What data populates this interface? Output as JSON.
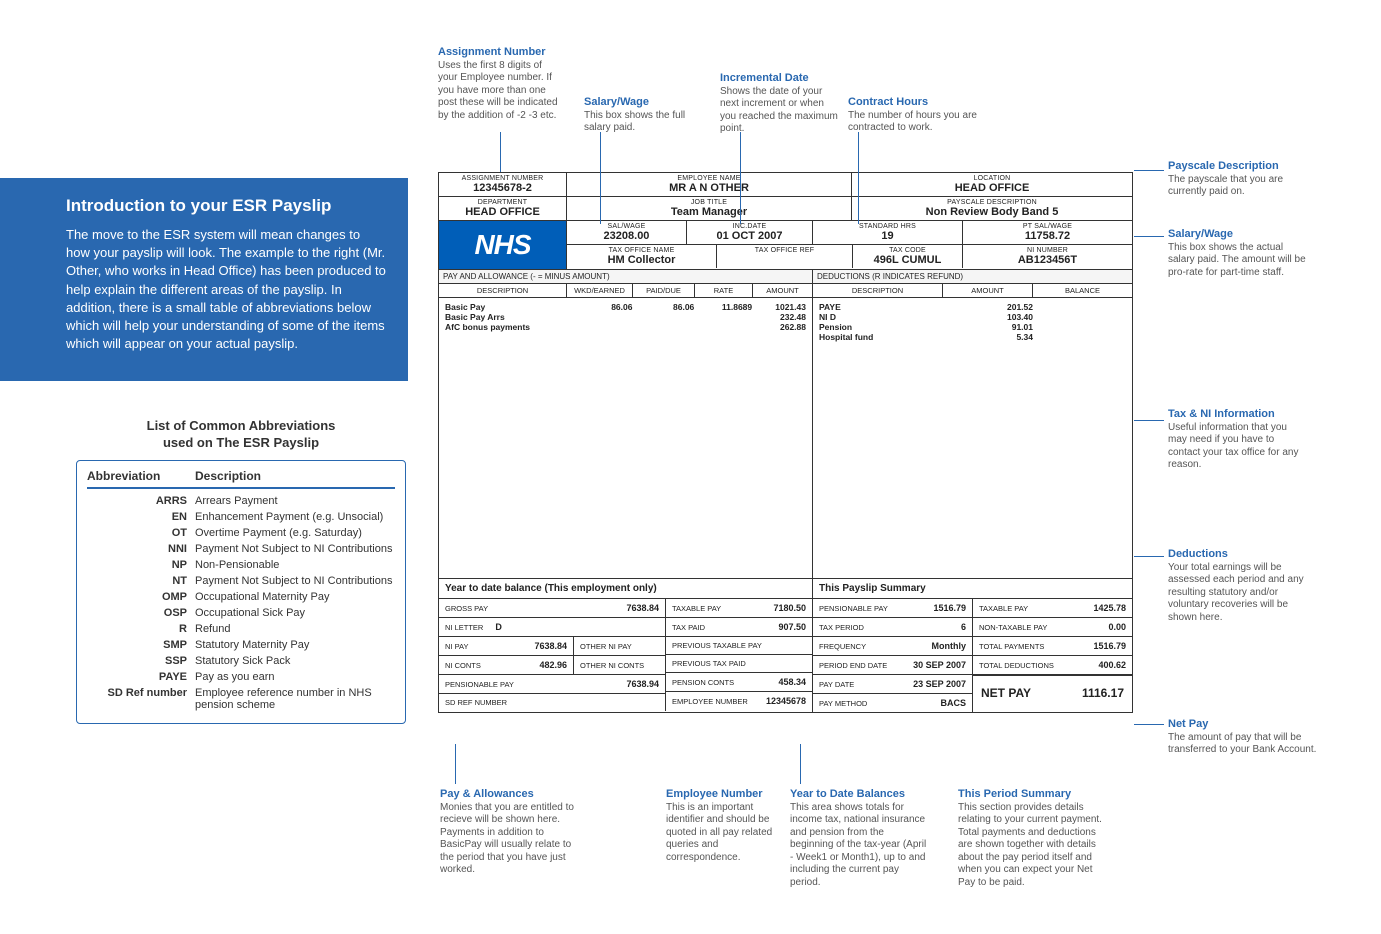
{
  "intro": {
    "title": "Introduction to your ESR Payslip",
    "body": "The move to the ESR system will mean changes to how your payslip will look. The example to the right (Mr. Other, who works in Head Office) has been produced to help explain the different areas of the payslip. In addition, there is a small table of abbreviations below which will help your understanding of some of the items which will appear on your actual payslip."
  },
  "abbrev": {
    "title1": "List of Common Abbreviations",
    "title2": "used on The ESR Payslip",
    "hdr_abbr": "Abbreviation",
    "hdr_desc": "Description",
    "rows": [
      {
        "a": "ARRS",
        "d": "Arrears Payment"
      },
      {
        "a": "EN",
        "d": "Enhancement Payment (e.g. Unsocial)"
      },
      {
        "a": "OT",
        "d": "Overtime Payment (e.g. Saturday)"
      },
      {
        "a": "NNI",
        "d": "Payment Not Subject to NI Contributions"
      },
      {
        "a": "NP",
        "d": "Non-Pensionable"
      },
      {
        "a": "NT",
        "d": "Payment Not Subject to NI Contributions"
      },
      {
        "a": "OMP",
        "d": "Occupational Maternity Pay"
      },
      {
        "a": "OSP",
        "d": "Occupational Sick Pay"
      },
      {
        "a": "R",
        "d": "Refund"
      },
      {
        "a": "SMP",
        "d": "Statutory Maternity Pay"
      },
      {
        "a": "SSP",
        "d": "Statutory Sick Pack"
      },
      {
        "a": "PAYE",
        "d": "Pay as you earn"
      },
      {
        "a": "SD Ref number",
        "d": "Employee reference number in NHS pension scheme"
      }
    ]
  },
  "payslip": {
    "logo": "NHS",
    "assignment_number_lbl": "ASSIGNMENT NUMBER",
    "assignment_number": "12345678-2",
    "employee_name_lbl": "EMPLOYEE NAME",
    "employee_name": "MR A N OTHER",
    "location_lbl": "LOCATION",
    "location": "HEAD OFFICE",
    "department_lbl": "DEPARTMENT",
    "department": "HEAD OFFICE",
    "job_title_lbl": "JOB TITLE",
    "job_title": "Team Manager",
    "payscale_lbl": "PAYSCALE DESCRIPTION",
    "payscale": "Non Review Body Band 5",
    "salwage_lbl": "SAL/WAGE",
    "salwage": "23208.00",
    "incdate_lbl": "INC.DATE",
    "incdate": "01 OCT 2007",
    "stdhrs_lbl": "STANDARD HRS",
    "stdhrs": "19",
    "ptsal_lbl": "PT SAL/WAGE",
    "ptsal": "11758.72",
    "taxoffice_lbl": "TAX OFFICE NAME",
    "taxoffice": "HM Collector",
    "taxref_lbl": "TAX OFFICE REF",
    "taxref": "",
    "taxcode_lbl": "TAX CODE",
    "taxcode": "496L CUMUL",
    "ninum_lbl": "NI NUMBER",
    "ninum": "AB123456T",
    "pay_section_hdr": "PAY AND ALLOWANCE (- = MINUS AMOUNT)",
    "ded_section_hdr": "DEDUCTIONS (R INDICATES REFUND)",
    "pay_cols": {
      "desc": "DESCRIPTION",
      "wkd": "WKD/EARNED",
      "paid": "PAID/DUE",
      "rate": "RATE",
      "amt": "AMOUNT"
    },
    "ded_cols": {
      "desc": "DESCRIPTION",
      "amt": "AMOUNT",
      "bal": "BALANCE"
    },
    "pay_rows": [
      {
        "desc": "Basic Pay",
        "wkd": "86.06",
        "paid": "86.06",
        "rate": "11.8689",
        "amt": "1021.43"
      },
      {
        "desc": "Basic Pay Arrs",
        "wkd": "",
        "paid": "",
        "rate": "",
        "amt": "232.48"
      },
      {
        "desc": "AfC bonus payments",
        "wkd": "",
        "paid": "",
        "rate": "",
        "amt": "262.88"
      }
    ],
    "ded_rows": [
      {
        "desc": "PAYE",
        "amt": "201.52",
        "bal": ""
      },
      {
        "desc": "NI D",
        "amt": "103.40",
        "bal": ""
      },
      {
        "desc": "Pension",
        "amt": "91.01",
        "bal": ""
      },
      {
        "desc": "Hospital fund",
        "amt": "5.34",
        "bal": ""
      }
    ],
    "ytd_hdr": "Year to date balance (This employment only)",
    "summary_hdr": "This Payslip Summary",
    "ytd": {
      "gross_pay_l": "GROSS PAY",
      "gross_pay": "7638.84",
      "taxable_pay_l": "TAXABLE PAY",
      "taxable_pay": "7180.50",
      "ni_letter_l": "NI LETTER",
      "ni_letter": "D",
      "tax_paid_l": "TAX PAID",
      "tax_paid": "907.50",
      "ni_pay_l": "NI PAY",
      "ni_pay": "7638.84",
      "other_ni_pay_l": "OTHER NI PAY",
      "other_ni_pay": "",
      "prev_taxable_l": "PREVIOUS TAXABLE PAY",
      "prev_taxable": "",
      "ni_conts_l": "NI CONTS",
      "ni_conts": "482.96",
      "other_ni_conts_l": "OTHER NI CONTS",
      "other_ni_conts": "",
      "prev_tax_paid_l": "PREVIOUS TAX PAID",
      "prev_tax_paid": "",
      "pensionable_l": "PENSIONABLE PAY",
      "pensionable": "7638.94",
      "pension_conts_l": "PENSION CONTS",
      "pension_conts": "458.34",
      "sdref_l": "SD REF NUMBER",
      "sdref": "",
      "empnum_l": "EMPLOYEE NUMBER",
      "empnum": "12345678"
    },
    "summary": {
      "pensionable_l": "PENSIONABLE PAY",
      "pensionable": "1516.79",
      "taxable_l": "TAXABLE PAY",
      "taxable": "1425.78",
      "tax_period_l": "TAX PERIOD",
      "tax_period": "6",
      "nontaxable_l": "NON-TAXABLE PAY",
      "nontaxable": "0.00",
      "freq_l": "FREQUENCY",
      "freq": "Monthly",
      "total_pay_l": "TOTAL PAYMENTS",
      "total_pay": "1516.79",
      "period_end_l": "PERIOD END DATE",
      "period_end": "30 SEP 2007",
      "total_ded_l": "TOTAL DEDUCTIONS",
      "total_ded": "400.62",
      "paydate_l": "PAY DATE",
      "paydate": "23 SEP 2007",
      "paymethod_l": "PAY METHOD",
      "paymethod": "BACS",
      "netpay_l": "NET PAY",
      "netpay": "1116.17"
    }
  },
  "annot": {
    "assignment": {
      "t": "Assignment Number",
      "d": "Uses the first 8 digits of your Employee number. If you have more than one post these will be indicated by the addition of -2 -3 etc."
    },
    "salary1": {
      "t": "Salary/Wage",
      "d": "This box shows the full salary paid."
    },
    "incdate": {
      "t": "Incremental Date",
      "d": "Shows the date of your next increment or when you reached the maximum point."
    },
    "contract": {
      "t": "Contract Hours",
      "d": "The number of hours you are contracted to work."
    },
    "payscale": {
      "t": "Payscale Description",
      "d": "The payscale that you are currently paid on."
    },
    "salary2": {
      "t": "Salary/Wage",
      "d": "This box shows the actual salary paid. The amount will be pro-rate for part-time staff."
    },
    "taxni": {
      "t": "Tax & NI Information",
      "d": "Useful information that you may need if you have to contact your tax office for any reason."
    },
    "ded": {
      "t": "Deductions",
      "d": "Your total earnings will be assessed each period and any resulting statutory and/or voluntary recoveries will be shown here."
    },
    "netpay": {
      "t": "Net Pay",
      "d": "The amount of pay that will be transferred to your Bank Account."
    },
    "payallow": {
      "t": "Pay & Allowances",
      "d": "Monies that you are entitled to recieve will be shown here. Payments in addition to BasicPay will usually relate to the period that you have just worked."
    },
    "empnum": {
      "t": "Employee Number",
      "d": "This is an important identifier and should be quoted in all pay related queries and correspondence."
    },
    "ytd": {
      "t": "Year to Date Balances",
      "d": "This area shows totals for income tax, national insurance and pension from the beginning of the tax-year (April - Week1 or Month1), up to and including the current pay period."
    },
    "thisperiod": {
      "t": "This Period Summary",
      "d": "This section provides details relating to your current payment. Total payments and deductions are shown together with details about the pay period itself and when you can expect your Net Pay to be paid."
    }
  }
}
